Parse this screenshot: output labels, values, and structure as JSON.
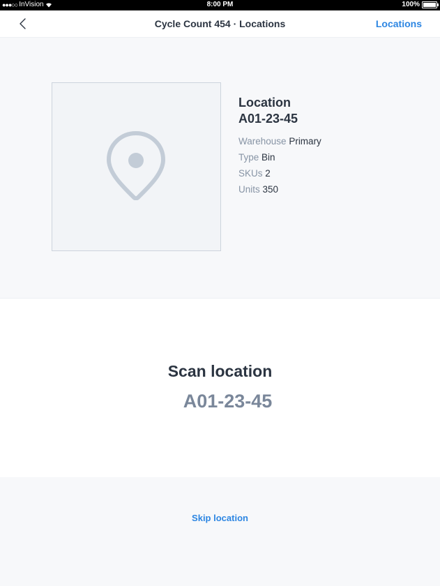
{
  "status_bar": {
    "carrier": "InVision",
    "time": "8:00 PM",
    "battery": "100%"
  },
  "nav": {
    "title": "Cycle Count 454 · Locations",
    "action_label": "Locations"
  },
  "location": {
    "heading": "Location",
    "code": "A01-23-45",
    "fields": [
      {
        "key": "Warehouse",
        "value": "Primary"
      },
      {
        "key": "Type",
        "value": "Bin"
      },
      {
        "key": "SKUs",
        "value": "2"
      },
      {
        "key": "Units",
        "value": "350"
      }
    ]
  },
  "scan": {
    "title": "Scan location",
    "code": "A01-23-45"
  },
  "footer": {
    "skip_label": "Skip location"
  },
  "icons": {
    "back": "chevron-left-icon",
    "placeholder": "map-pin-icon",
    "signal": "signal-dots-icon",
    "wifi": "wifi-icon",
    "battery": "battery-icon"
  },
  "colors": {
    "accent": "#2d86e2",
    "text_dark": "#2b3441",
    "text_muted": "#8794a5",
    "scan_code": "#7a879a"
  }
}
